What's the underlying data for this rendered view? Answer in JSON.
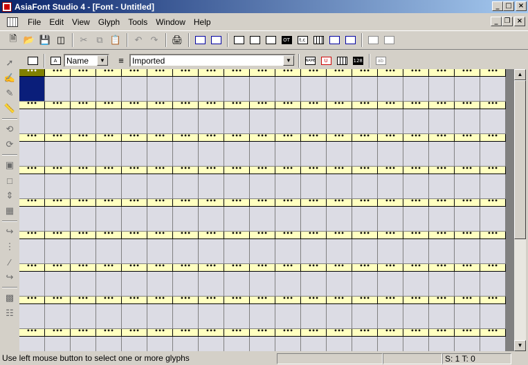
{
  "window": {
    "title": "AsiaFont Studio 4 - [Font - Untitled]",
    "minimize": "_",
    "maximize": "□",
    "close": "×",
    "mdi_minimize": "_",
    "mdi_restore": "❐",
    "mdi_close": "×"
  },
  "menu": {
    "items": [
      "File",
      "Edit",
      "View",
      "Glyph",
      "Tools",
      "Window",
      "Help"
    ]
  },
  "toolbar2": {
    "name_combo": "Name",
    "filter_combo": "Imported",
    "name_icon": "NAME",
    "unicode_icon": "U",
    "code_icon": "128"
  },
  "grid": {
    "header_marker": "•••",
    "rows": 9,
    "cols": 19,
    "selected_row": 0,
    "selected_col": 0
  },
  "status": {
    "message": "Use left mouse button to select one or more glyphs",
    "panel2": "",
    "panel3": "",
    "counts": "S: 1 T: 0"
  },
  "colors": {
    "title_gradient_start": "#0a246a",
    "header_yellow": "#ffffc0",
    "selected_cell": "#0a1e7a",
    "selected_header": "#808000"
  }
}
